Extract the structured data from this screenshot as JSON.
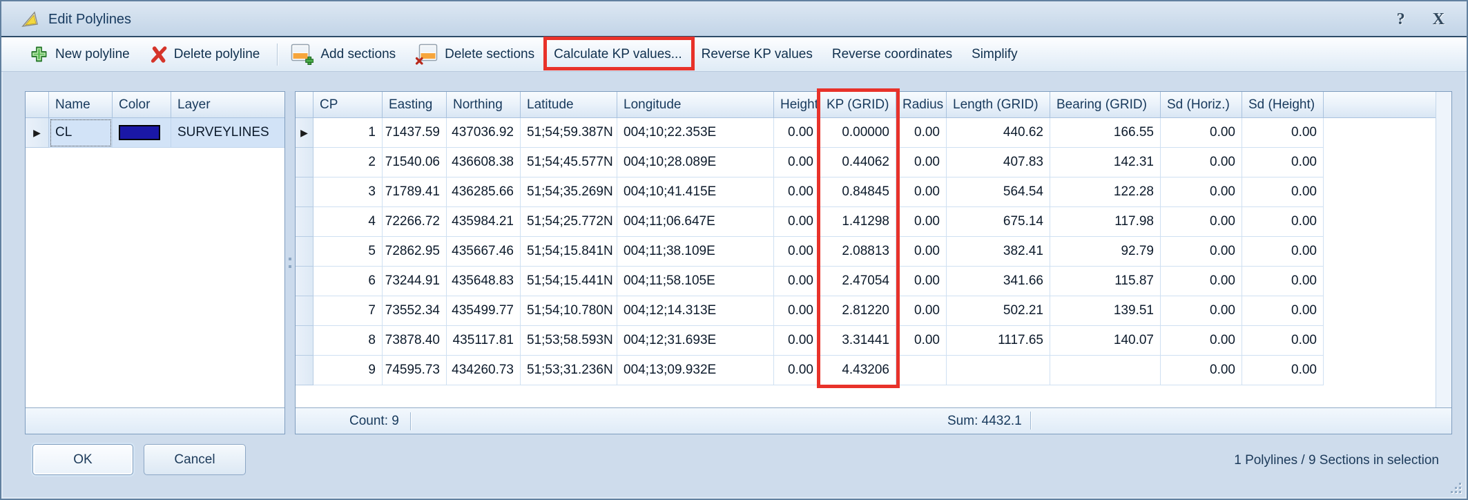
{
  "window": {
    "title": "Edit Polylines",
    "help_glyph": "?",
    "close_glyph": "X"
  },
  "toolbar": {
    "items": [
      {
        "label": "New polyline",
        "icon": "new-polyline-icon"
      },
      {
        "label": "Delete polyline",
        "icon": "delete-polyline-icon"
      },
      {
        "type": "separator"
      },
      {
        "label": "Add sections",
        "icon": "add-sections-icon"
      },
      {
        "label": "Delete sections",
        "icon": "delete-sections-icon"
      },
      {
        "label": "Calculate KP values...",
        "annotated": true
      },
      {
        "label": "Reverse KP values"
      },
      {
        "label": "Reverse coordinates"
      },
      {
        "label": "Simplify"
      }
    ]
  },
  "polyline_list": {
    "columns": [
      "Name",
      "Color",
      "Layer"
    ],
    "rows": [
      {
        "name": "CL",
        "color": "#1a17a6",
        "layer": "SURVEYLINES",
        "selected": true
      }
    ]
  },
  "sections_table": {
    "columns": [
      "CP",
      "Easting",
      "Northing",
      "Latitude",
      "Longitude",
      "Height",
      "KP (GRID)",
      "Radius",
      "Length (GRID)",
      "Bearing (GRID)",
      "Sd (Horiz.)",
      "Sd (Height)"
    ],
    "rows": [
      [
        "1",
        "71437.59",
        "437036.92",
        "51;54;59.387N",
        "004;10;22.353E",
        "0.00",
        "0.00000",
        "0.00",
        "440.62",
        "166.55",
        "0.00",
        "0.00"
      ],
      [
        "2",
        "71540.06",
        "436608.38",
        "51;54;45.577N",
        "004;10;28.089E",
        "0.00",
        "0.44062",
        "0.00",
        "407.83",
        "142.31",
        "0.00",
        "0.00"
      ],
      [
        "3",
        "71789.41",
        "436285.66",
        "51;54;35.269N",
        "004;10;41.415E",
        "0.00",
        "0.84845",
        "0.00",
        "564.54",
        "122.28",
        "0.00",
        "0.00"
      ],
      [
        "4",
        "72266.72",
        "435984.21",
        "51;54;25.772N",
        "004;11;06.647E",
        "0.00",
        "1.41298",
        "0.00",
        "675.14",
        "117.98",
        "0.00",
        "0.00"
      ],
      [
        "5",
        "72862.95",
        "435667.46",
        "51;54;15.841N",
        "004;11;38.109E",
        "0.00",
        "2.08813",
        "0.00",
        "382.41",
        "92.79",
        "0.00",
        "0.00"
      ],
      [
        "6",
        "73244.91",
        "435648.83",
        "51;54;15.441N",
        "004;11;58.105E",
        "0.00",
        "2.47054",
        "0.00",
        "341.66",
        "115.87",
        "0.00",
        "0.00"
      ],
      [
        "7",
        "73552.34",
        "435499.77",
        "51;54;10.780N",
        "004;12;14.313E",
        "0.00",
        "2.81220",
        "0.00",
        "502.21",
        "139.51",
        "0.00",
        "0.00"
      ],
      [
        "8",
        "73878.40",
        "435117.81",
        "51;53;58.593N",
        "004;12;31.693E",
        "0.00",
        "3.31441",
        "0.00",
        "1117.65",
        "140.07",
        "0.00",
        "0.00"
      ],
      [
        "9",
        "74595.73",
        "434260.73",
        "51;53;31.236N",
        "004;13;09.932E",
        "0.00",
        "4.43206",
        "",
        "",
        "",
        "0.00",
        "0.00"
      ]
    ],
    "footer": {
      "count": "Count: 9",
      "sum": "Sum: 4432.1"
    }
  },
  "buttons": {
    "ok": "OK",
    "cancel": "Cancel"
  },
  "status": "1 Polylines / 9 Sections in selection",
  "annotation_color": "#e8322a"
}
